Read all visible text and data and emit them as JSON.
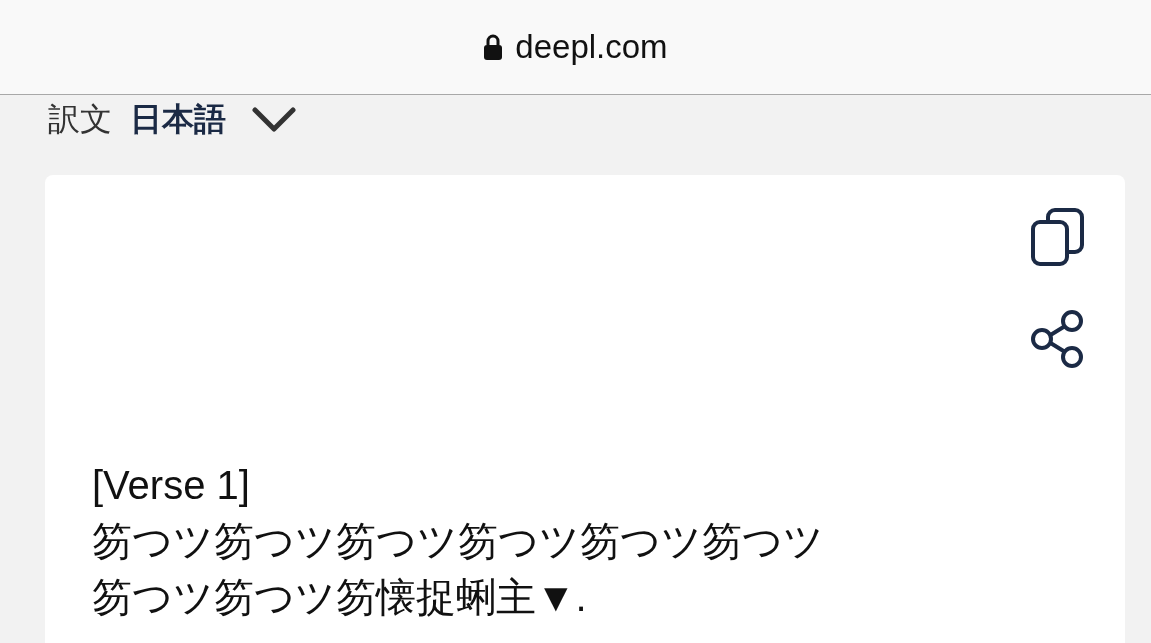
{
  "address_bar": {
    "url": "deepl.com"
  },
  "target_language": {
    "label": "訳文",
    "language": "日本語"
  },
  "translation": {
    "lines": [
      "[Verse 1]",
      "笏つツ笏つツ笏つツ笏つツ笏つツ笏つツ",
      "笏つツ笏つツ笏懐捉蜊主▼."
    ]
  }
}
